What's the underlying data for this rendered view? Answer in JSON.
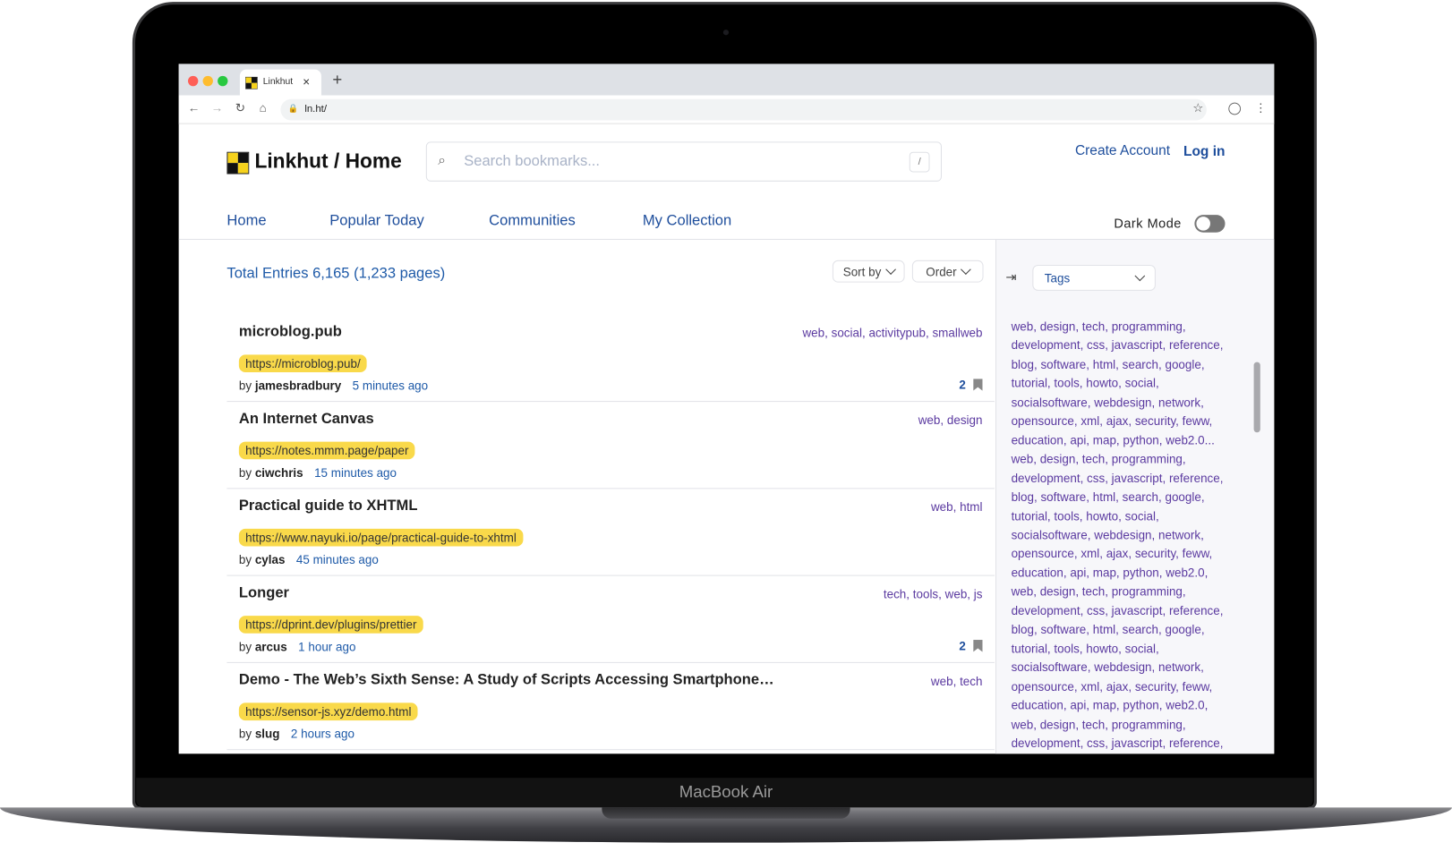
{
  "device": {
    "label": "MacBook Air"
  },
  "browser": {
    "tab_title": "Linkhut",
    "url": "ln.ht/"
  },
  "header": {
    "title": "Linkhut / Home",
    "search_placeholder": "Search bookmarks...",
    "search_shortcut": "/",
    "create_account": "Create Account",
    "login": "Log in"
  },
  "nav": {
    "items": [
      "Home",
      "Popular Today",
      "Communities",
      "My Collection"
    ],
    "dark_mode_label": "Dark Mode",
    "dark_mode_on": false
  },
  "main": {
    "total": "Total Entries 6,165 (1,233 pages)",
    "sort_label": "Sort by",
    "order_label": "Order",
    "entries": [
      {
        "title": "microblog.pub",
        "url": "https://microblog.pub/",
        "user": "jamesbradbury",
        "time": "5 minutes ago",
        "tags": "web, social, activitypub, smallweb",
        "count": "2"
      },
      {
        "title": "An Internet Canvas",
        "url": "https://notes.mmm.page/paper",
        "user": "ciwchris",
        "time": "15 minutes ago",
        "tags": "web, design",
        "count": ""
      },
      {
        "title": "Practical guide to XHTML",
        "url": "https://www.nayuki.io/page/practical-guide-to-xhtml",
        "user": "cylas",
        "time": "45 minutes ago",
        "tags": "web, html",
        "count": ""
      },
      {
        "title": "Longer",
        "url": "https://dprint.dev/plugins/prettier",
        "user": "arcus",
        "time": "1 hour ago",
        "tags": "tech, tools, web, js",
        "count": "2"
      },
      {
        "title": "Demo - The Web’s Sixth Sense: A Study of Scripts Accessing Smartphone…",
        "url": "https://sensor-js.xyz/demo.html",
        "user": "slug",
        "time": "2 hours ago",
        "tags": "web, tech",
        "count": ""
      }
    ],
    "by_label": "by"
  },
  "sidebar": {
    "select_label": "Tags",
    "tag_lines": [
      "web, design, tech, programming,",
      "development, css, javascript, reference,",
      "blog, software, html, search, google,",
      "tutorial, tools, howto, social,",
      "socialsoftware, webdesign, network,",
      "opensource, xml, ajax, security, feww,",
      "education, api, map, python, web2.0...",
      "web, design, tech, programming,",
      "development, css, javascript, reference,",
      "blog, software, html, search, google,",
      "tutorial, tools, howto, social,",
      "socialsoftware, webdesign, network,",
      "opensource, xml, ajax, security, feww,",
      "education, api, map, python, web2.0,",
      "web, design, tech, programming,",
      "development, css, javascript, reference,",
      "blog, software, html, search, google,",
      "tutorial, tools, howto, social,",
      "socialsoftware, webdesign, network,",
      "opensource, xml, ajax, security, feww,",
      "education, api, map, python, web2.0,",
      "web, design, tech, programming,",
      "development, css, javascript, reference,",
      "blog, software, html, search, google,"
    ]
  },
  "colors": {
    "link": "#1e4e9c",
    "tag": "#5b3aa0",
    "url_highlight": "#f9d94a"
  }
}
